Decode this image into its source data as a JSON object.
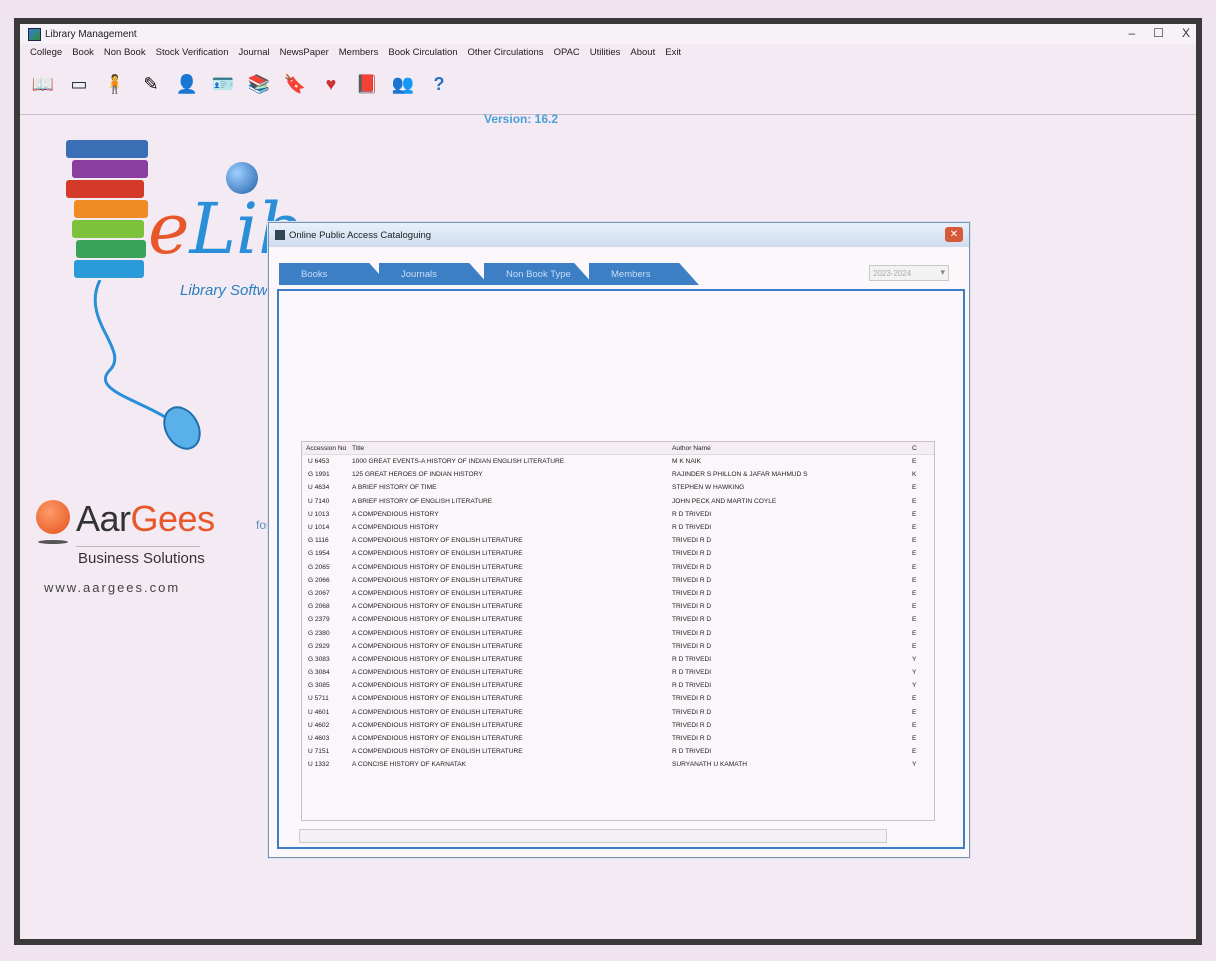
{
  "window": {
    "title": "Library Management",
    "controls": [
      "–",
      "☐",
      "X"
    ]
  },
  "menu": [
    "College",
    "Book",
    "Non Book",
    "Stock Verification",
    "Journal",
    "NewsPaper",
    "Members",
    "Book Circulation",
    "Other Circulations",
    "OPAC",
    "Utilities",
    "About",
    "Exit"
  ],
  "toolbar_icons": [
    "book-icon",
    "window-icon",
    "person-icon",
    "pen-icon",
    "user-icon",
    "card-icon",
    "books-icon",
    "bookmark-icon",
    "heart-book-icon",
    "library-icon",
    "people-icon",
    "help-icon"
  ],
  "version": "Version: 16.2",
  "logo": {
    "elib_e": "e",
    "elib_li": "Lib",
    "tagline": "Library Software"
  },
  "company": {
    "name_dark": "Aar",
    "name_orange": "Gees",
    "sub": "Business Solutions",
    "url": "www.aargees.com",
    "faint": "for"
  },
  "dialog": {
    "title": "Online Public Access Cataloguing",
    "tabs": [
      "Books",
      "Journals",
      "Non Book Type",
      "Members"
    ],
    "year_select": "2023-2024",
    "columns": [
      "Accession No",
      "Title",
      "Author Name",
      "C"
    ],
    "rows": [
      {
        "acc": "U 6453",
        "title": "1000 GREAT EVENTS-A HISTORY OF INDIAN ENGLISH LITERATURE",
        "author": "M K NAIK",
        "c": "E"
      },
      {
        "acc": "G 1991",
        "title": "125 GREAT HEROES OF INDIAN HISTORY",
        "author": "RAJINDER S PHILLON & JAFAR MAHMUD S",
        "c": "K"
      },
      {
        "acc": "U 4634",
        "title": "A BRIEF HISTORY OF TIME",
        "author": "STEPHEN W HAWKING",
        "c": "E"
      },
      {
        "acc": "U 7140",
        "title": "A BRIEF HISTORY OF ENGLISH LITERATURE",
        "author": "JOHN PECK AND MARTIN COYLE",
        "c": "E"
      },
      {
        "acc": "U 1013",
        "title": "A COMPENDIOUS HISTORY",
        "author": "R D TRIVEDI",
        "c": "E"
      },
      {
        "acc": "U 1014",
        "title": "A COMPENDIOUS HISTORY",
        "author": "R D TRIVEDI",
        "c": "E"
      },
      {
        "acc": "G 1116",
        "title": "A COMPENDIOUS HISTORY OF ENGLISH LITERATURE",
        "author": "TRIVEDI R D",
        "c": "E"
      },
      {
        "acc": "G 1954",
        "title": "A COMPENDIOUS HISTORY OF ENGLISH LITERATURE",
        "author": "TRIVEDI R D",
        "c": "E"
      },
      {
        "acc": "G 2065",
        "title": "A COMPENDIOUS HISTORY OF ENGLISH LITERATURE",
        "author": "TRIVEDI R D",
        "c": "E"
      },
      {
        "acc": "G 2066",
        "title": "A COMPENDIOUS HISTORY OF ENGLISH LITERATURE",
        "author": "TRIVEDI R D",
        "c": "E"
      },
      {
        "acc": "G 2067",
        "title": "A COMPENDIOUS HISTORY OF ENGLISH LITERATURE",
        "author": "TRIVEDI R D",
        "c": "E"
      },
      {
        "acc": "G 2068",
        "title": "A COMPENDIOUS HISTORY OF ENGLISH LITERATURE",
        "author": "TRIVEDI R D",
        "c": "E"
      },
      {
        "acc": "G 2379",
        "title": "A COMPENDIOUS HISTORY OF ENGLISH LITERATURE",
        "author": "TRIVEDI R D",
        "c": "E"
      },
      {
        "acc": "G 2380",
        "title": "A COMPENDIOUS HISTORY OF ENGLISH LITERATURE",
        "author": "TRIVEDI R D",
        "c": "E"
      },
      {
        "acc": "G 2929",
        "title": "A COMPENDIOUS HISTORY OF ENGLISH LITERATURE",
        "author": "TRIVEDI R D",
        "c": "E"
      },
      {
        "acc": "G 3083",
        "title": "A COMPENDIOUS HISTORY OF ENGLISH LITERATURE",
        "author": "R D TRIVEDI",
        "c": "Y"
      },
      {
        "acc": "G 3084",
        "title": "A COMPENDIOUS HISTORY OF ENGLISH LITERATURE",
        "author": "R D TRIVEDI",
        "c": "Y"
      },
      {
        "acc": "G 3085",
        "title": "A COMPENDIOUS HISTORY OF ENGLISH LITERATURE",
        "author": "R D TRIVEDI",
        "c": "Y"
      },
      {
        "acc": "U 5711",
        "title": "A COMPENDIOUS HISTORY OF ENGLISH LITERATURE",
        "author": "TRIVEDI R D",
        "c": "E"
      },
      {
        "acc": "U 4601",
        "title": "A COMPENDIOUS HISTORY OF ENGLISH LITERATURE",
        "author": "TRIVEDI R D",
        "c": "E"
      },
      {
        "acc": "U 4602",
        "title": "A COMPENDIOUS HISTORY OF ENGLISH LITERATURE",
        "author": "TRIVEDI R D",
        "c": "E"
      },
      {
        "acc": "U 4603",
        "title": "A COMPENDIOUS HISTORY OF ENGLISH LITERATURE",
        "author": "TRIVEDI R D",
        "c": "E"
      },
      {
        "acc": "U 7151",
        "title": "A COMPENDIOUS HISTORY OF ENGLISH LITERATURE",
        "author": "R D TRIVEDI",
        "c": "E"
      },
      {
        "acc": "U 1332",
        "title": "A CONCISE HISTORY OF KARNATAK",
        "author": "SURYANATH U KAMATH",
        "c": "Y"
      }
    ]
  },
  "colors": {
    "tab_blue": "#3c7fc4",
    "accent_orange": "#e8572a",
    "version_blue": "#4aa0d8"
  }
}
